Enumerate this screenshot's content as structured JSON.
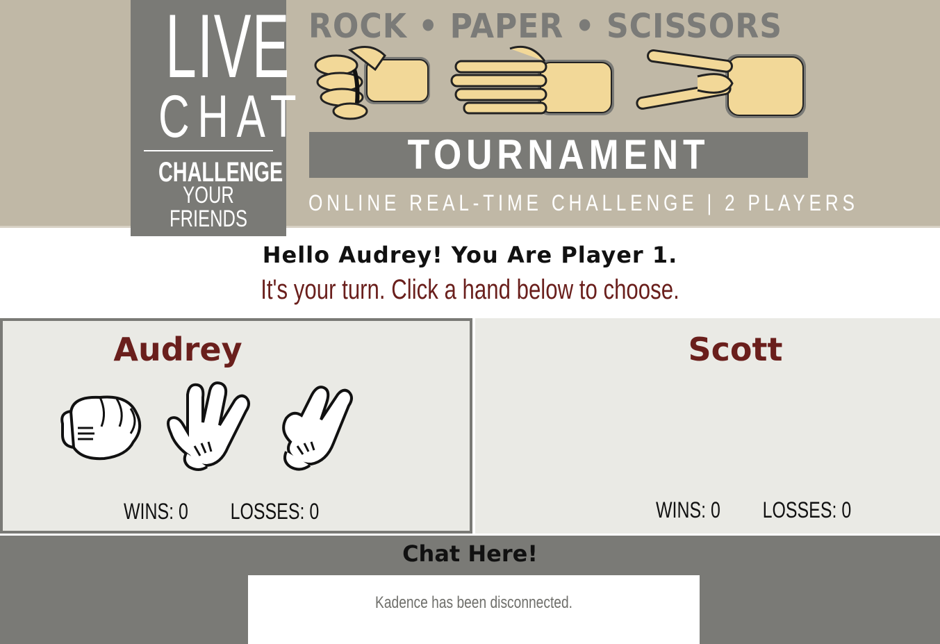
{
  "banner": {
    "live": "LIVE",
    "chat": "CHAT",
    "challenge": "CHALLENGE",
    "your_friends": "YOUR FRIENDS",
    "rps_title": "ROCK • PAPER • SCISSORS",
    "tournament": "TOURNAMENT",
    "subtitle": "ONLINE REAL-TIME CHALLENGE | 2 PLAYERS"
  },
  "greeting": {
    "hello": "Hello Audrey! You Are Player 1.",
    "turn": "It's your turn. Click a hand below to choose."
  },
  "player1": {
    "name": "Audrey",
    "wins_label": "WINS: 0",
    "losses_label": "LOSSES: 0",
    "choices": [
      "rock-glove-icon",
      "paper-glove-icon",
      "scissors-glove-icon"
    ]
  },
  "player2": {
    "name": "Scott",
    "wins_label": "WINS: 0",
    "losses_label": "LOSSES: 0"
  },
  "chat": {
    "title": "Chat Here!",
    "messages": [
      "Kadence has been disconnected."
    ]
  },
  "colors": {
    "banner_bg": "#c0b8a6",
    "ribbon": "#7a7a76",
    "accent_maroon": "#6a1f1c",
    "panel_bg": "#eaeae5",
    "skin": "#f2d898"
  }
}
